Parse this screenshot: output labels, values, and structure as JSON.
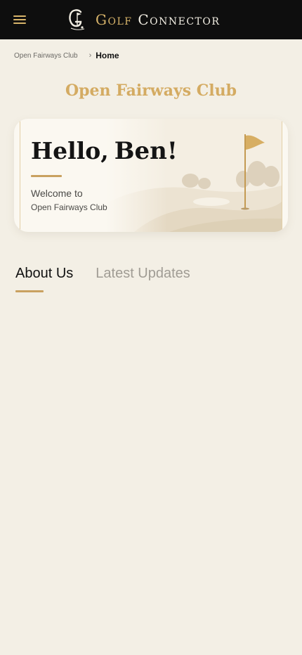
{
  "header": {
    "menu_icon": "hamburger-menu-icon",
    "logo_icon": "golf-connector-logo",
    "brand_word1": "Golf",
    "brand_word2": "Connector"
  },
  "breadcrumb": {
    "parent": "Open Fairways Club",
    "separator": "›",
    "current": "Home"
  },
  "club_title": "Open Fairways Club",
  "welcome_card": {
    "greeting": "Hello,",
    "user_name": "Ben!",
    "welcome_line": "Welcome to",
    "club_name": "Open Fairways Club",
    "illustration": "golf-course-flag-illustration"
  },
  "tabs": [
    {
      "label": "About Us",
      "active": true
    },
    {
      "label": "Latest Updates",
      "active": false
    }
  ],
  "colors": {
    "background": "#f3efe5",
    "topbar": "#0e0e0e",
    "accent_gold": "#d4ab62",
    "text_dark": "#111111",
    "tab_inactive": "#a09c94"
  }
}
